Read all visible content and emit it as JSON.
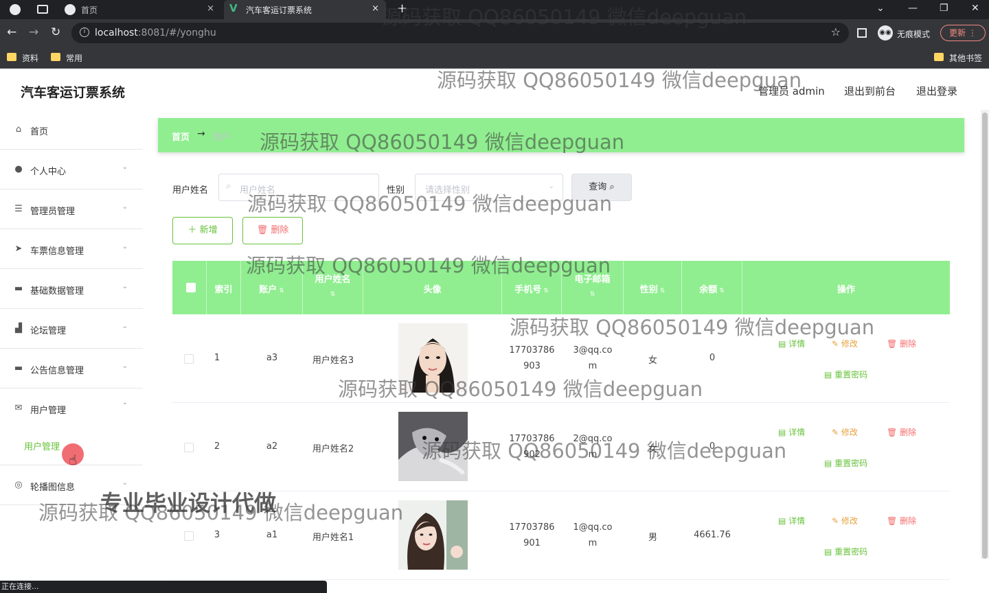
{
  "browser": {
    "tabs": [
      {
        "title": "首页",
        "close": "×"
      },
      {
        "title": "汽车客运订票系统",
        "close": "×"
      }
    ],
    "new_tab": "+",
    "window_controls": {
      "chevron": "⌄",
      "minimize": "—",
      "restore": "❐",
      "close": "✕"
    },
    "url_host": "localhost",
    "url_rest": ":8081/#/yonghu",
    "incognito_label": "无痕模式",
    "update_label": "更新",
    "bookmarks": [
      "资料",
      "常用"
    ],
    "other_bookmarks": "其他书签",
    "status_text": "正在连接..."
  },
  "app": {
    "title": "汽车客运订票系统",
    "user_label": "管理员 admin",
    "back_to_front": "退出到前台",
    "logout": "退出登录"
  },
  "sidebar": {
    "items": [
      {
        "label": "首页",
        "icon": "home-icon"
      },
      {
        "label": "个人中心",
        "icon": "user-icon"
      },
      {
        "label": "管理员管理",
        "icon": "list-icon"
      },
      {
        "label": "车票信息管理",
        "icon": "send-icon"
      },
      {
        "label": "基础数据管理",
        "icon": "monitor-icon"
      },
      {
        "label": "论坛管理",
        "icon": "chart-icon"
      },
      {
        "label": "公告信息管理",
        "icon": "monitor-icon"
      },
      {
        "label": "用户管理",
        "icon": "mail-icon"
      },
      {
        "label": "轮播图信息",
        "icon": "compass-icon"
      }
    ],
    "sub_item": "用户管理"
  },
  "breadcrumb": {
    "home": "首页",
    "separator": "→",
    "current": "用户"
  },
  "search": {
    "name_label": "用户姓名",
    "name_placeholder": "用户姓名",
    "gender_label": "性别",
    "gender_placeholder": "请选择性别",
    "query_label": "查询"
  },
  "actions": {
    "add": "新增",
    "delete": "删除"
  },
  "table": {
    "headers": [
      "索引",
      "账户",
      "用户姓名",
      "头像",
      "手机号",
      "电子邮箱",
      "性别",
      "余额",
      "操作"
    ],
    "rows": [
      {
        "index": "1",
        "account": "a3",
        "name": "用户姓名3",
        "phone_1": "17703786",
        "phone_2": "903",
        "email_1": "3@qq.co",
        "email_2": "m",
        "gender": "女",
        "balance": "0"
      },
      {
        "index": "2",
        "account": "a2",
        "name": "用户姓名2",
        "phone_1": "17703786",
        "phone_2": "902",
        "email_1": "2@qq.co",
        "email_2": "m",
        "gender": "女",
        "balance": "0"
      },
      {
        "index": "3",
        "account": "a1",
        "name": "用户姓名1",
        "phone_1": "17703786",
        "phone_2": "901",
        "email_1": "1@qq.co",
        "email_2": "m",
        "gender": "男",
        "balance": "4661.76"
      }
    ],
    "ops": {
      "detail": "详情",
      "edit": "修改",
      "delete": "删除",
      "reset": "重置密码"
    }
  },
  "watermark": {
    "text": "源码获取 QQ86050149 微信deepguan",
    "text_strong": "专业毕业设计代做"
  },
  "colors": {
    "accent": "#90ee90",
    "success": "#67c23a",
    "danger": "#f56c6c",
    "warning": "#e6a23c"
  }
}
